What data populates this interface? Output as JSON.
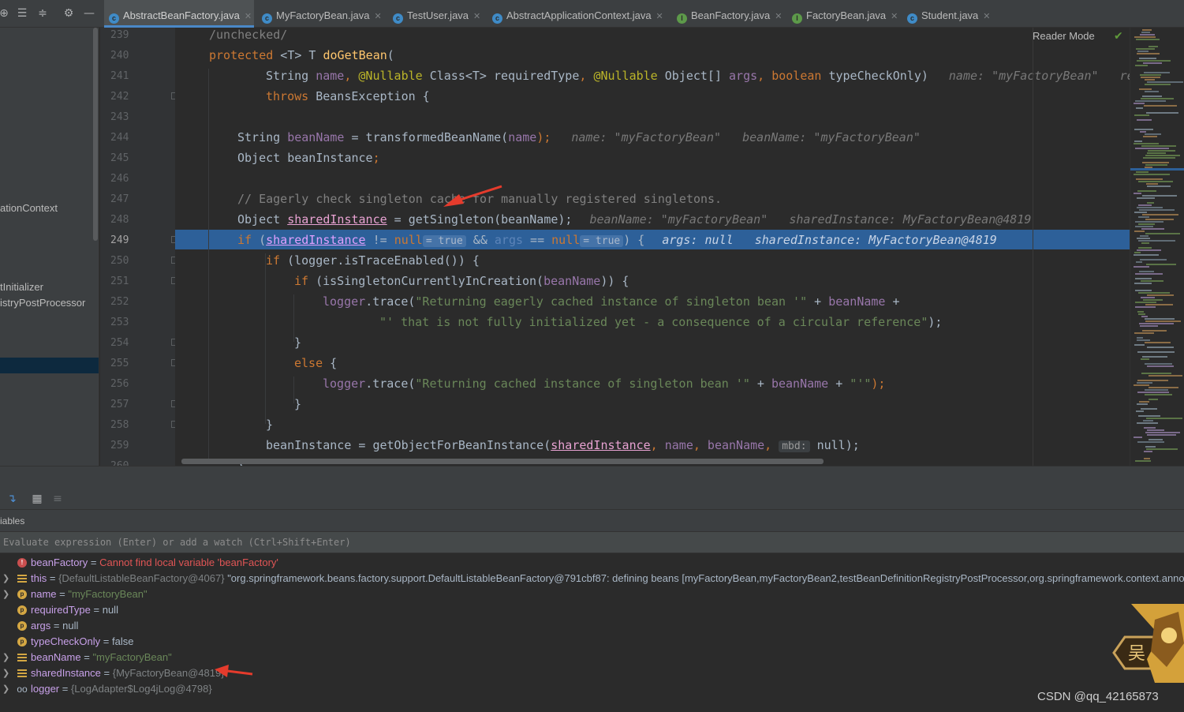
{
  "tabs": [
    {
      "label": "AbstractBeanFactory.java",
      "icon": "class-icon",
      "active": true
    },
    {
      "label": "MyFactoryBean.java",
      "icon": "class-icon",
      "active": false
    },
    {
      "label": "TestUser.java",
      "icon": "class-icon",
      "active": false
    },
    {
      "label": "AbstractApplicationContext.java",
      "icon": "class-icon",
      "active": false
    },
    {
      "label": "BeanFactory.java",
      "icon": "interface-icon",
      "active": false
    },
    {
      "label": "FactoryBean.java",
      "icon": "interface-icon",
      "active": false
    },
    {
      "label": "Student.java",
      "icon": "class-icon",
      "active": false
    }
  ],
  "project": {
    "items": [
      "ationContext",
      "tInitializer",
      "istryPostProcessor"
    ]
  },
  "editor": {
    "reader_mode": "Reader Mode",
    "current_line": 249,
    "line_numbers": [
      "239",
      "240",
      "241",
      "242",
      "243",
      "244",
      "245",
      "246",
      "247",
      "248",
      "249",
      "250",
      "251",
      "252",
      "253",
      "254",
      "255",
      "256",
      "257",
      "258",
      "259",
      "260"
    ],
    "l239": "/unchecked/",
    "l240_kw": "protected",
    "l240_rest": " <T> T ",
    "l240_fn": "doGetBean",
    "l240_end": "(",
    "l241_a": "String ",
    "l241_b": "name",
    "l241_c": ", ",
    "l241_d": "@Nullable",
    "l241_e": " Class<T> ",
    "l241_f": "requiredType",
    "l241_g": ", ",
    "l241_h": "@Nullable",
    "l241_i": " Object[] ",
    "l241_j": "args",
    "l241_k": ", ",
    "l241_l": "boolean",
    "l241_m": " typeCheckOnly)",
    "l241_dbg": "name: \"myFactoryBean\"   re",
    "l242_kw": "throws",
    "l242_rest": " BeansException {",
    "l244_a": "String ",
    "l244_b": "beanName",
    "l244_c": " = transformedBeanName(",
    "l244_d": "name",
    "l244_e": ");",
    "l244_dbg": "name: \"myFactoryBean\"   beanName: \"myFactoryBean\"",
    "l245_a": "Object ",
    "l245_b": "beanInstance",
    "l245_c": ";",
    "l247": "// Eagerly check singleton cache for manually registered singletons.",
    "l248_a": "Object ",
    "l248_b": "sharedInstance",
    "l248_c": " = getSingleton(beanName);",
    "l248_dbg": "beanName: \"myFactoryBean\"   sharedInstance: MyFactoryBean@4819",
    "l249_kw": "if",
    "l249_a": " (",
    "l249_b": "sharedInstance",
    "l249_c": " != ",
    "l249_d": "null",
    "l249_hint1": "= true",
    "l249_e": " && ",
    "l249_f": "args",
    "l249_g": " == ",
    "l249_h": "null",
    "l249_hint2": "= true",
    "l249_i": ") {",
    "l249_dbg": "args: null   sharedInstance: MyFactoryBean@4819",
    "l250_kw": "if",
    "l250_a": " (",
    "l250_b": "logger",
    "l250_c": ".isTraceEnabled()) {",
    "l251_kw": "if",
    "l251_a": " (isSingletonCurrentlyInCreation(",
    "l251_b": "beanName",
    "l251_c": ")) {",
    "l252_a": "logger",
    "l252_b": ".trace(",
    "l252_c": "\"Returning eagerly cached instance of singleton bean '\"",
    "l252_d": " + ",
    "l252_e": "beanName",
    "l252_f": " +",
    "l253_a": "\"' that is not fully initialized yet - a consequence of a circular reference\"",
    "l253_b": ");",
    "l254": "}",
    "l255_kw": "else",
    "l255_a": " {",
    "l256_a": "logger",
    "l256_b": ".trace(",
    "l256_c": "\"Returning cached instance of singleton bean '\"",
    "l256_d": " + ",
    "l256_e": "beanName",
    "l256_f": " + ",
    "l256_g": "\"'\"",
    "l256_h": ");",
    "l257": "}",
    "l258": "}",
    "l259_a": "beanInstance = getObjectForBeanInstance(",
    "l259_b": "sharedInstance",
    "l259_c": ", ",
    "l259_d": "name",
    "l259_e": ", ",
    "l259_f": "beanName",
    "l259_g": ", ",
    "l259_hint": "mbd:",
    "l259_h": " null);",
    "l260": "}"
  },
  "debugger": {
    "header": "iables",
    "eval_placeholder": "Evaluate expression (Enter) or add a watch (Ctrl+Shift+Enter)",
    "variables": [
      {
        "icon": "error-icon",
        "expandable": false,
        "name": "beanFactory",
        "eq": " = ",
        "value": "Cannot find local variable 'beanFactory'",
        "kind": "error"
      },
      {
        "icon": "field-icon",
        "expandable": true,
        "name": "this",
        "eq": " = ",
        "obj": "{DefaultListableBeanFactory@4067}",
        "value": " \"org.springframework.beans.factory.support.DefaultListableBeanFactory@791cbf87: defining beans [myFactoryBean,myFactoryBean2,testBeanDefinitionRegistryPostProcessor,org.springframework.context.annot",
        "kind": "obj"
      },
      {
        "icon": "param-icon",
        "expandable": true,
        "name": "name",
        "eq": " = ",
        "value": "\"myFactoryBean\"",
        "kind": "string"
      },
      {
        "icon": "param-icon",
        "expandable": false,
        "name": "requiredType",
        "eq": " = ",
        "value": "null",
        "kind": "plain"
      },
      {
        "icon": "param-icon",
        "expandable": false,
        "name": "args",
        "eq": " = ",
        "value": "null",
        "kind": "plain"
      },
      {
        "icon": "param-icon",
        "expandable": false,
        "name": "typeCheckOnly",
        "eq": " = ",
        "value": "false",
        "kind": "plain"
      },
      {
        "icon": "field-icon",
        "expandable": true,
        "name": "beanName",
        "eq": " = ",
        "value": "\"myFactoryBean\"",
        "kind": "string"
      },
      {
        "icon": "field-icon",
        "expandable": true,
        "name": "sharedInstance",
        "eq": " = ",
        "obj": "{MyFactoryBean@4819}",
        "value": "",
        "kind": "obj"
      },
      {
        "icon": "watch-icon",
        "expandable": true,
        "name": "logger",
        "eq": " = ",
        "obj": "{LogAdapter$Log4jLog@4798}",
        "value": "",
        "kind": "obj"
      }
    ]
  },
  "watermark": "CSDN @qq_42165873",
  "colors": {
    "exec_line": "#2d6099",
    "keyword": "#cc7832",
    "string": "#6a8759",
    "annotation_arrow": "#e53b2c"
  }
}
